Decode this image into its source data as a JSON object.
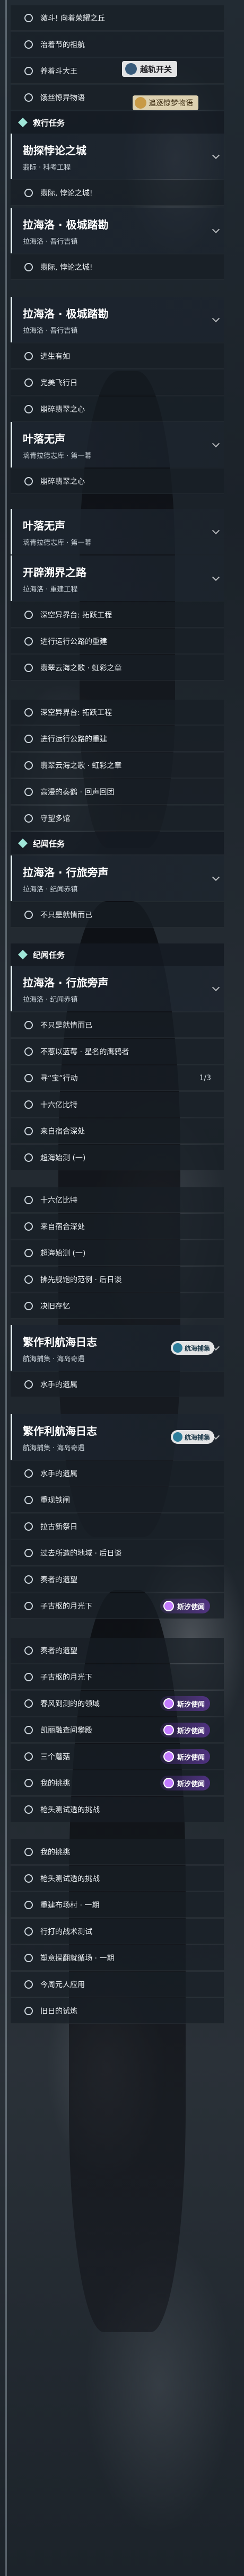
{
  "labels": {
    "top_tag": "越轨开关",
    "dream_tag": "追逐惊梦物语"
  },
  "categories": [
    {
      "id": "c1",
      "name": "救行任务"
    },
    {
      "id": "c2",
      "name": "纪闻任务"
    },
    {
      "id": "c3",
      "name": "纪闻任务"
    }
  ],
  "quests": [
    {
      "title": "勘探悖论之城",
      "sub": "翡际 · 科考工程"
    },
    {
      "title": "拉海洛 · 极城踏勘",
      "sub": "拉海洛 · 吾行吉镇"
    },
    {
      "title": "拉海洛 · 极城踏勘",
      "sub": "拉海洛 · 吾行吉镇"
    },
    {
      "title": "叶落无声",
      "sub": "璃青拉德志库 · 第一幕"
    },
    {
      "title": "叶落无声",
      "sub": "璃青拉德志库 · 第一幕"
    },
    {
      "title": "开辟溯界之路",
      "sub": "拉海洛 · 重建工程"
    },
    {
      "title": "拉海洛 · 行旅旁声",
      "sub": "拉海洛 · 纪闻赤镇"
    },
    {
      "title": "拉海洛 · 行旅旁声",
      "sub": "拉海洛 · 纪闻赤镇"
    },
    {
      "title": "繁作利航海日志",
      "sub": "航海捕集 · 海岛奇遇",
      "tag": "航海捕集"
    },
    {
      "title": "繁作利航海日志",
      "sub": "航海捕集 · 海岛奇遇",
      "tag": "航海捕集"
    }
  ],
  "items": [
    "激斗! 向着荣耀之丘",
    "治着节的祖航",
    "养着斗大王",
    "饿丝惊异物语",
    "翡际, 悖论之城!",
    "翡际, 悖论之城!",
    "进生有如",
    "完美飞行日",
    "崩碎翡翠之心",
    "崩碎翡翠之心",
    "深空异界台: 拓跃工程",
    "进行运行公路的重建",
    "翡翠云海之歌 · 虹彩之章",
    "深空异界台: 拓跃工程",
    "进行运行公路的重建",
    "翡翠云海之歌 · 虹彩之章",
    "高漫的奏鹤 · 回声回团",
    "守望多馆",
    "不只是就情而已",
    "不只是就情而已",
    "不惹以蓝莓 · 星名的鹰鸦者",
    "寻“宝”行动",
    "十六亿比特",
    "来自宿合深处",
    "超海始测 (一)",
    "十六亿比特",
    "来自宿合深处",
    "超海始测 (一)",
    "拂先舰饱的范例 · 后日谈",
    "决旧存忆",
    "水手的遗属",
    "水手的遗属",
    "重现铁闸",
    "拉古新祭日",
    "过去所造的地域 · 后日谈",
    "奏者的遗望",
    "子古枢的月光下",
    "奏者的遗望",
    "子古枢的月光下",
    "春风到测的的领域",
    "凯丽融查间攀殿",
    "三个蘑菇",
    "我的挑挑",
    "枪头测试透的挑战",
    "我的挑挑",
    "枪头测试透的挑战",
    "重建布场村 · 一期",
    "行打的战术测试",
    "塑意探翻就循场 · 一期",
    "今周元人应用",
    "旧日的试炼"
  ],
  "value_item": "1/3",
  "badge_label": "斯汐使闻",
  "colors": {
    "accent": "#9fe6d8",
    "purple_badge": "#7a3ec8"
  }
}
